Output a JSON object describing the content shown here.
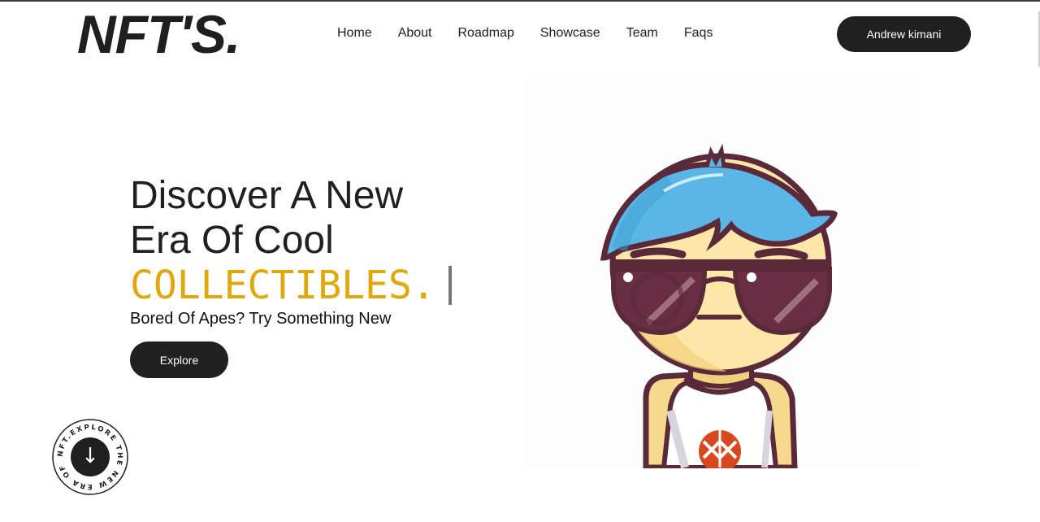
{
  "brand": {
    "logo": "NFT'S."
  },
  "nav": {
    "items": [
      {
        "label": "Home"
      },
      {
        "label": "About"
      },
      {
        "label": "Roadmap"
      },
      {
        "label": "Showcase"
      },
      {
        "label": "Team"
      },
      {
        "label": "Faqs"
      }
    ]
  },
  "user": {
    "name": "Andrew kimani"
  },
  "hero": {
    "line1": "Discover A New",
    "line2": "Era Of Cool",
    "typed": "COLLECTIBLES.",
    "subtitle": "Bored Of Apes? Try Something New",
    "cta": "Explore"
  },
  "badge": {
    "ring_text": "NFT.EXPLORE THE NEW ERA OF ",
    "arrow": "↓"
  },
  "colors": {
    "accent": "#e1a80c",
    "dark": "#202020",
    "hair": "#5ab6e6",
    "outline": "#5a2a3a"
  }
}
